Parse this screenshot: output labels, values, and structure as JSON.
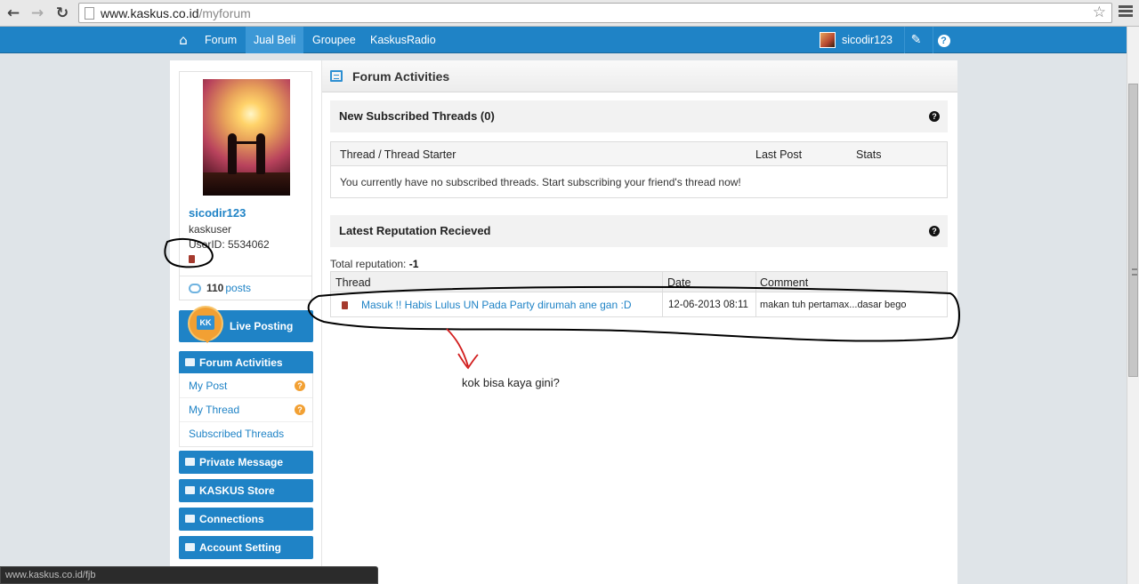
{
  "browser": {
    "url_host": "www.kaskus.co.id",
    "url_path": "/myforum",
    "back_icon": "back-arrow-icon",
    "forward_icon": "forward-arrow-icon",
    "reload_icon": "reload-icon"
  },
  "navbar": {
    "items": [
      {
        "label": "Forum"
      },
      {
        "label": "Jual Beli"
      },
      {
        "label": "Groupee"
      },
      {
        "label": "KaskusRadio"
      }
    ],
    "active": "Jual Beli",
    "username": "sicodir123",
    "color": "#1f83c6"
  },
  "profile": {
    "username": "sicodir123",
    "role": "kaskuser",
    "userid": "UserID: 5534062",
    "post_count": "110",
    "posts_label": "posts"
  },
  "sidebar": {
    "live_posting": "Live Posting",
    "live_badge": "KK",
    "forum_activities": "Forum Activities",
    "sub_items": [
      {
        "label": "My Post"
      },
      {
        "label": "My Thread"
      },
      {
        "label": "Subscribed Threads"
      }
    ],
    "private_message": "Private Message",
    "kaskus_store": "KASKUS Store",
    "connections": "Connections",
    "account_setting": "Account Setting"
  },
  "main": {
    "title": "Forum Activities",
    "subscribed": {
      "title": "New Subscribed Threads (0)",
      "columns": [
        "Thread / Thread Starter",
        "Last Post",
        "Stats"
      ],
      "empty_message": "You currently have no subscribed threads. Start subscribing your friend's thread now!"
    },
    "reputation": {
      "title": "Latest Reputation Recieved",
      "total_label": "Total reputation:",
      "total_value": "-1",
      "columns": [
        "Thread",
        "Date",
        "Comment"
      ],
      "rows": [
        {
          "thread": "Masuk !! Habis Lulus UN Pada Party dirumah ane gan :D",
          "date": "12-06-2013 08:11",
          "comment": "makan tuh pertamax...dasar bego"
        }
      ]
    }
  },
  "annotation": {
    "note": "kok bisa kaya gini?"
  },
  "status_bar": {
    "url": "www.kaskus.co.id/fjb"
  }
}
